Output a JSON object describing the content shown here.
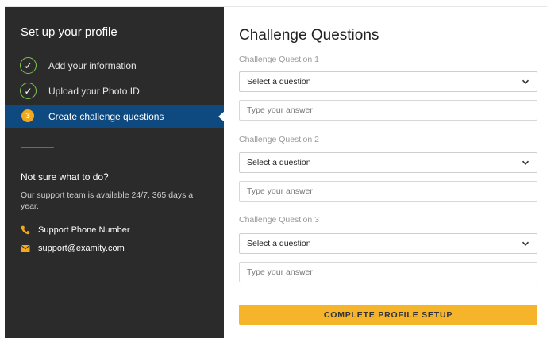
{
  "sidebar": {
    "title": "Set up your profile",
    "steps": [
      {
        "marker": "✓",
        "label": "Add your information",
        "state": "done"
      },
      {
        "marker": "✓",
        "label": "Upload your Photo ID",
        "state": "done"
      },
      {
        "marker": "3",
        "label": "Create challenge questions",
        "state": "active"
      }
    ],
    "help": {
      "title": "Not sure what to do?",
      "text": "Our support team is available 24/7, 365 days a year.",
      "phone_label": "Support Phone Number",
      "email": "support@examity.com"
    }
  },
  "main": {
    "title": "Challenge Questions",
    "questions": [
      {
        "label": "Challenge Question 1",
        "select_value": "Select a question",
        "answer_placeholder": "Type your answer"
      },
      {
        "label": "Challenge Question 2",
        "select_value": "Select a question",
        "answer_placeholder": "Type your answer"
      },
      {
        "label": "Challenge Question 3",
        "select_value": "Select a question",
        "answer_placeholder": "Type your answer"
      }
    ],
    "submit_label": "COMPLETE PROFILE SETUP"
  },
  "colors": {
    "sidebar_bg": "#2b2b2b",
    "active_step_bg": "#0e4a80",
    "check_green": "#7ec451",
    "accent_orange": "#f2a81d",
    "button_yellow": "#f5b42a"
  },
  "icons": {
    "phone": "phone-icon",
    "email": "envelope-icon",
    "dropdown": "chevron-down-icon",
    "done": "check-circle-icon"
  }
}
